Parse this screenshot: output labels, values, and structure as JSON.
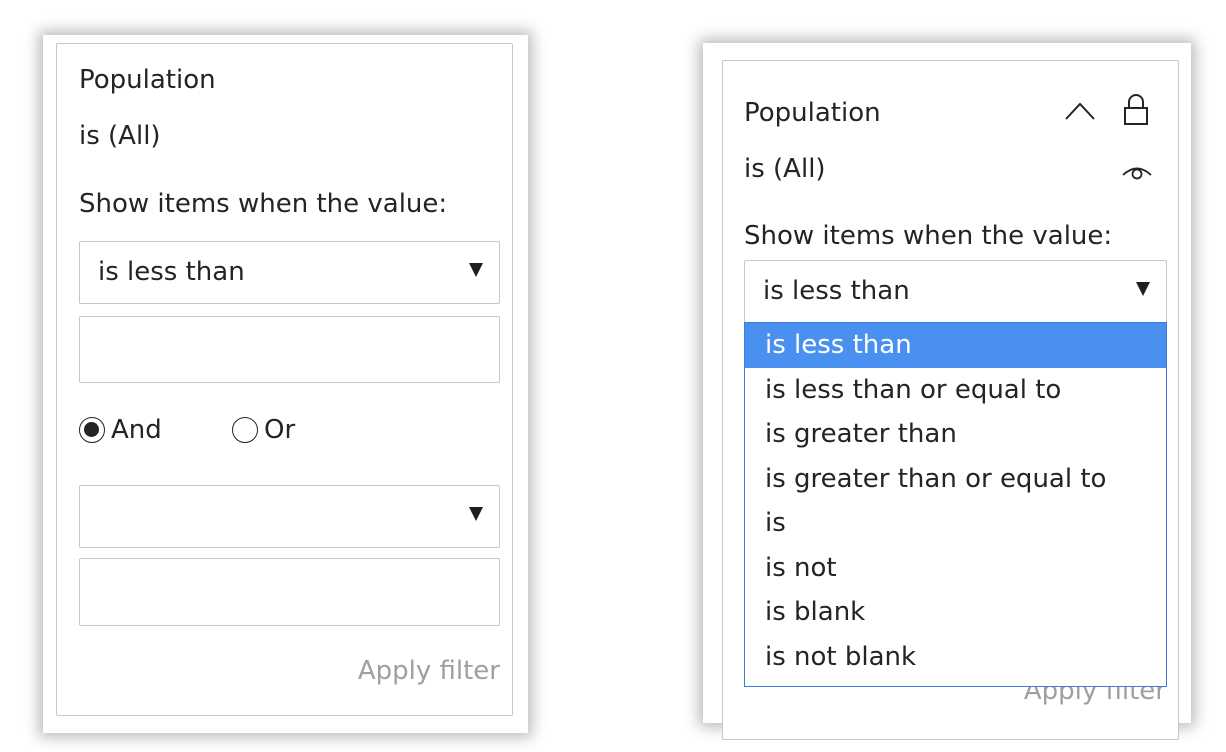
{
  "left_panel": {
    "field_name": "Population",
    "summary": "is (All)",
    "instruction": "Show items when the value:",
    "condition1_value": "is less than",
    "condition1_input": "",
    "logic": {
      "options": [
        "And",
        "Or"
      ],
      "selected": "And"
    },
    "condition2_value": "",
    "condition2_input": "",
    "apply_label": "Apply filter"
  },
  "right_panel": {
    "field_name": "Population",
    "summary": "is (All)",
    "instruction": "Show items when the value:",
    "condition1_value": "is less than",
    "dropdown_options": [
      "is less than",
      "is less than or equal to",
      "is greater than",
      "is greater than or equal to",
      "is",
      "is not",
      "is blank",
      "is not blank"
    ],
    "highlighted_option": "is less than",
    "apply_label": "Apply filter",
    "icons": [
      "collapse-chevron-icon",
      "lock-icon",
      "eye-icon"
    ]
  },
  "colors": {
    "highlight": "#4a90f0",
    "listbox_border": "#3e7cd9",
    "card_border": "#c8c6c4",
    "muted_text": "#a19f9d"
  }
}
